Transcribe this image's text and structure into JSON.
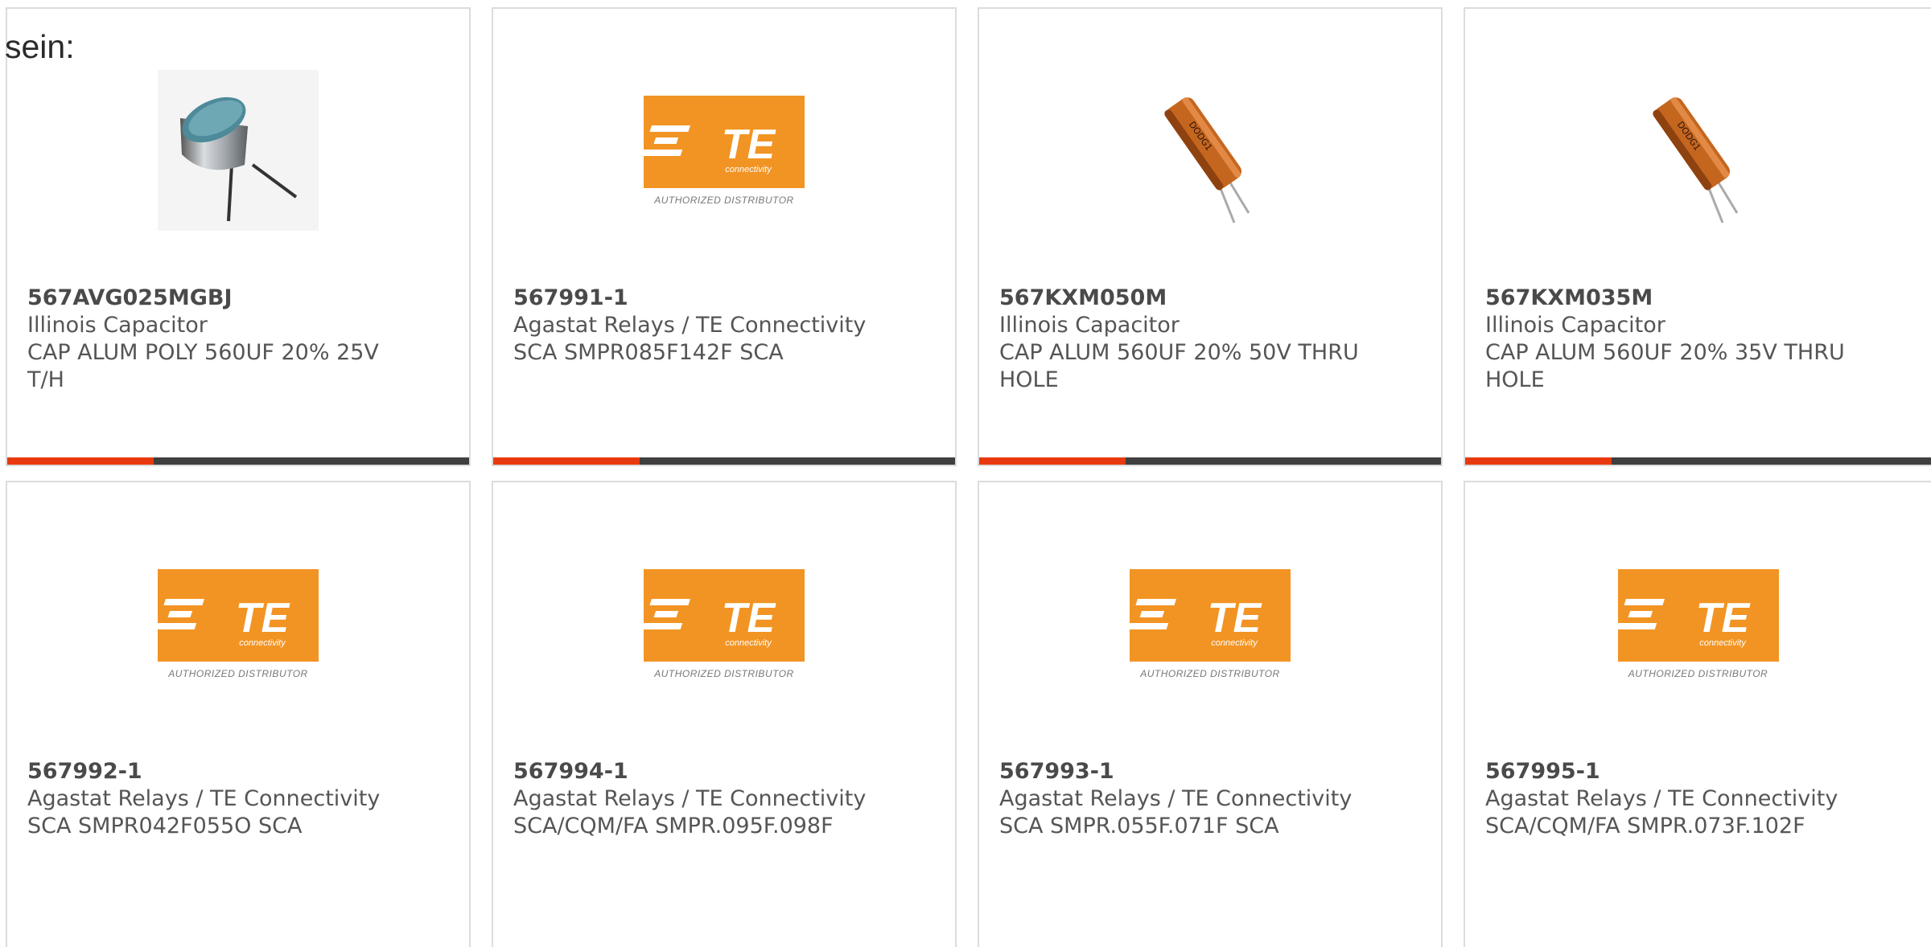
{
  "intro_text": "sein:",
  "brand_colors": {
    "te_orange": "#f29423",
    "accent_red": "#e8390e",
    "bar_dark": "#3f3f3f"
  },
  "te_logo": {
    "wordmark": "TE",
    "subtext": "connectivity",
    "caption": "AUTHORIZED DISTRIBUTOR"
  },
  "products": [
    {
      "part_number": "567AVG025MGBJ",
      "manufacturer": "Illinois Capacitor",
      "description": "CAP ALUM POLY 560UF 20% 25V T/H",
      "image": "capacitor-polymer-image"
    },
    {
      "part_number": "567991-1",
      "manufacturer": "Agastat Relays / TE Connectivity",
      "description": "SCA SMPR085F142F SCA",
      "image": "te-connectivity-logo"
    },
    {
      "part_number": "567KXM050M",
      "manufacturer": "Illinois Capacitor",
      "description": "CAP ALUM 560UF 20% 50V THRU HOLE",
      "image": "capacitor-electrolytic-image"
    },
    {
      "part_number": "567KXM035M",
      "manufacturer": "Illinois Capacitor",
      "description": "CAP ALUM 560UF 20% 35V THRU HOLE",
      "image": "capacitor-electrolytic-image"
    },
    {
      "part_number": "567992-1",
      "manufacturer": "Agastat Relays / TE Connectivity",
      "description": "SCA SMPR042F055O SCA",
      "image": "te-connectivity-logo"
    },
    {
      "part_number": "567994-1",
      "manufacturer": "Agastat Relays / TE Connectivity",
      "description": "SCA/CQM/FA SMPR.095F.098F",
      "image": "te-connectivity-logo"
    },
    {
      "part_number": "567993-1",
      "manufacturer": "Agastat Relays / TE Connectivity",
      "description": "SCA SMPR.055F.071F SCA",
      "image": "te-connectivity-logo"
    },
    {
      "part_number": "567995-1",
      "manufacturer": "Agastat Relays / TE Connectivity",
      "description": "SCA/CQM/FA SMPR.073F.102F",
      "image": "te-connectivity-logo"
    }
  ]
}
